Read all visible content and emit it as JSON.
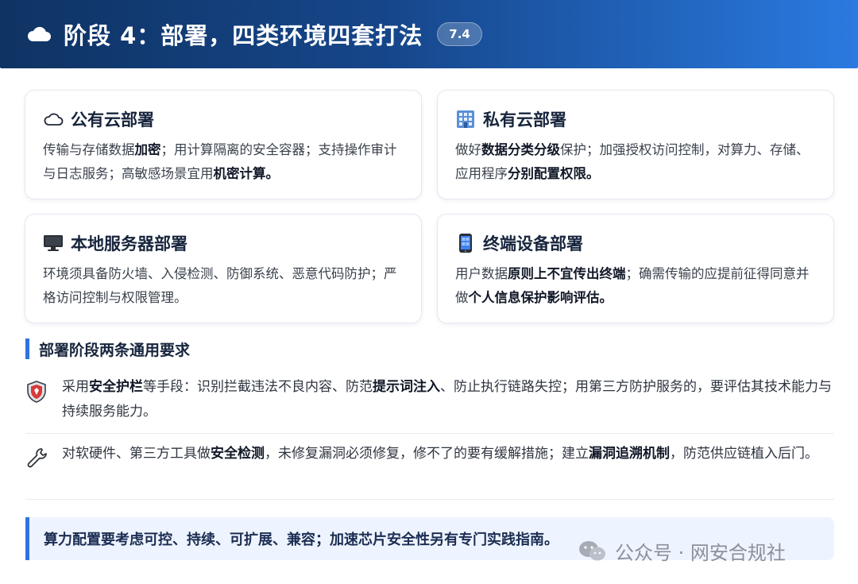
{
  "header": {
    "title": "阶段 4：部署，四类环境四套打法",
    "badge": "7.4"
  },
  "cards": [
    {
      "title": "公有云部署",
      "icon": "cloud-outline-icon",
      "body": [
        {
          "t": "传输与存储数据",
          "b": false
        },
        {
          "t": "加密",
          "b": true
        },
        {
          "t": "；用计算隔离的安全容器；支持操作审计与日志服务；高敏感场景宜用",
          "b": false
        },
        {
          "t": "机密计算。",
          "b": true
        }
      ]
    },
    {
      "title": "私有云部署",
      "icon": "office-building-icon",
      "body": [
        {
          "t": "做好",
          "b": false
        },
        {
          "t": "数据分类分级",
          "b": true
        },
        {
          "t": "保护；加强授权访问控制，对算力、存储、应用程序",
          "b": false
        },
        {
          "t": "分别配置权限。",
          "b": true
        }
      ]
    },
    {
      "title": "本地服务器部署",
      "icon": "desktop-computer-icon",
      "body": [
        {
          "t": "环境须具备防火墙、入侵检测、防御系统、恶意代码防护；严格访问控制与权限管理。",
          "b": false
        }
      ]
    },
    {
      "title": "终端设备部署",
      "icon": "mobile-phone-icon",
      "body": [
        {
          "t": "用户数据",
          "b": false
        },
        {
          "t": "原则上不宜传出终端",
          "b": true
        },
        {
          "t": "；确需传输的应提前征得同意并做",
          "b": false
        },
        {
          "t": "个人信息保护影响评估。",
          "b": true
        }
      ]
    }
  ],
  "section": {
    "title": "部署阶段两条通用要求"
  },
  "requirements": [
    {
      "icon": "shield-icon",
      "body": [
        {
          "t": "采用",
          "b": false
        },
        {
          "t": "安全护栏",
          "b": true
        },
        {
          "t": "等手段：识别拦截违法不良内容、防范",
          "b": false
        },
        {
          "t": "提示词注入",
          "b": true
        },
        {
          "t": "、防止执行链路失控；用第三方防护服务的，要评估其技术能力与持续服务能力。",
          "b": false
        }
      ]
    },
    {
      "icon": "wrench-icon",
      "body": [
        {
          "t": "对软硬件、第三方工具做",
          "b": false
        },
        {
          "t": "安全检测",
          "b": true
        },
        {
          "t": "，未修复漏洞必须修复，修不了的要有缓解措施；建立",
          "b": false
        },
        {
          "t": "漏洞追溯机制",
          "b": true
        },
        {
          "t": "，防范供应链植入后门。",
          "b": false
        }
      ]
    }
  ],
  "note": {
    "text": "算力配置要考虑可控、持续、可扩展、兼容；加速芯片安全性另有专门实践指南。"
  },
  "watermark": {
    "text": "公众号 · 网安合规社"
  },
  "colors": {
    "accent": "#2f72e0",
    "header_start": "#0f3363",
    "header_end": "#2a7ae0"
  }
}
